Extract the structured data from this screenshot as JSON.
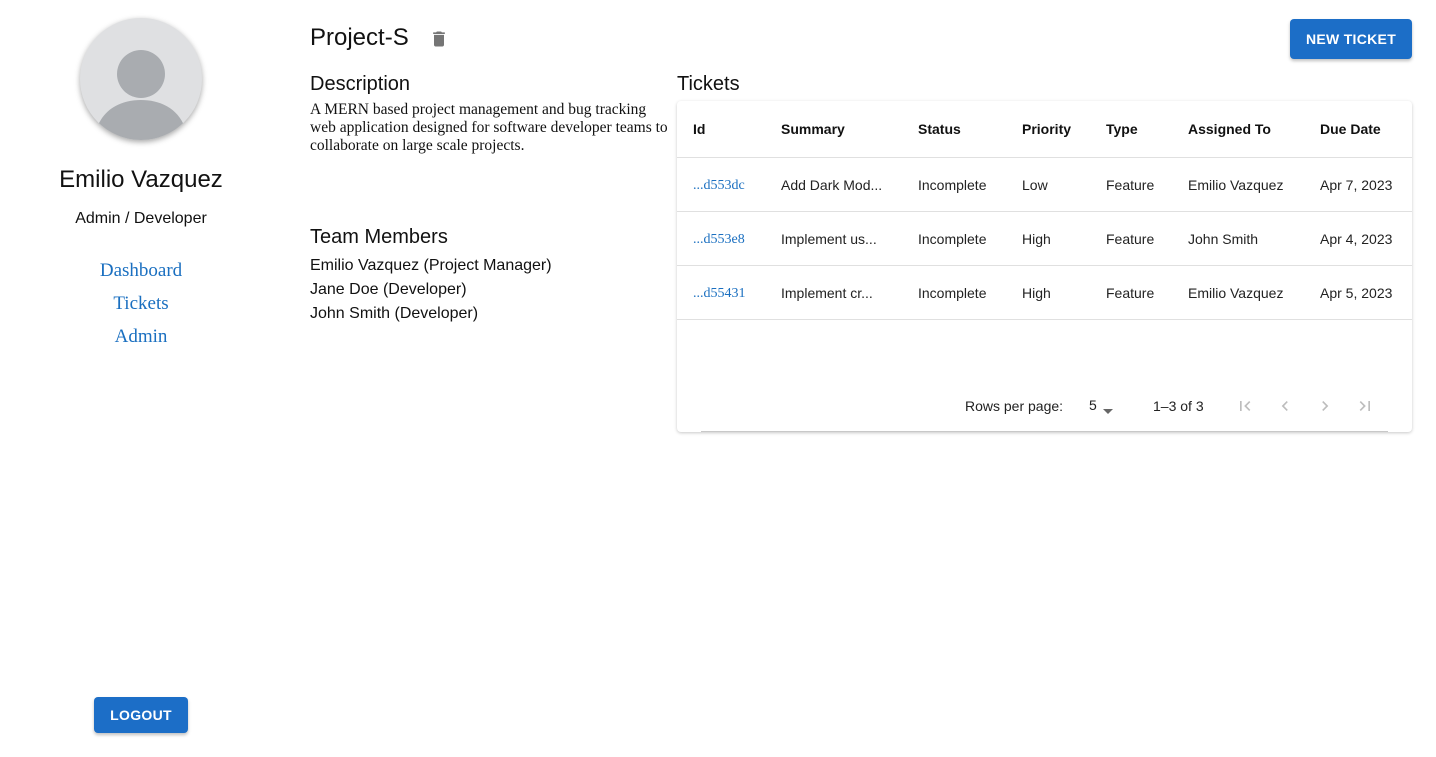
{
  "sidebar": {
    "user_name": "Emilio Vazquez",
    "user_role": "Admin / Developer",
    "nav": [
      "Dashboard",
      "Tickets",
      "Admin"
    ],
    "logout_label": "LOGOUT"
  },
  "project": {
    "title": "Project-S",
    "new_ticket_label": "NEW TICKET",
    "description_heading": "Description",
    "description": "A MERN based project management and bug tracking web application designed for software developer teams to collaborate on large scale projects.",
    "team_heading": "Team Members",
    "team": [
      "Emilio Vazquez (Project Manager)",
      "Jane Doe (Developer)",
      "John Smith (Developer)"
    ]
  },
  "tickets": {
    "heading": "Tickets",
    "columns": [
      "Id",
      "Summary",
      "Status",
      "Priority",
      "Type",
      "Assigned To",
      "Due Date"
    ],
    "rows": [
      {
        "id": "...d553dc",
        "summary": "Add Dark Mod...",
        "status": "Incomplete",
        "priority": "Low",
        "type": "Feature",
        "assigned": "Emilio Vazquez",
        "due": "Apr 7, 2023"
      },
      {
        "id": "...d553e8",
        "summary": "Implement us...",
        "status": "Incomplete",
        "priority": "High",
        "type": "Feature",
        "assigned": "John Smith",
        "due": "Apr 4, 2023"
      },
      {
        "id": "...d55431",
        "summary": "Implement cr...",
        "status": "Incomplete",
        "priority": "High",
        "type": "Feature",
        "assigned": "Emilio Vazquez",
        "due": "Apr 5, 2023"
      }
    ],
    "pagination": {
      "rows_per_page_label": "Rows per page:",
      "rows_per_page": "5",
      "range": "1–3 of 3"
    }
  },
  "colors": {
    "accent": "#1c6ec7",
    "link": "#1a6fc0",
    "avatar_bg": "#dfe0e2",
    "avatar_fg": "#a9acb0"
  }
}
